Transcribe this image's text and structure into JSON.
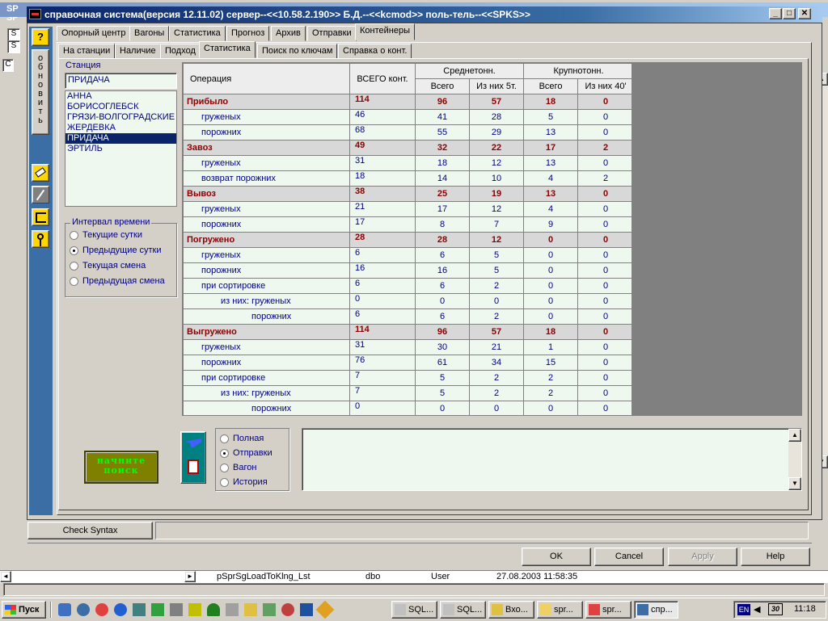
{
  "window": {
    "title": "справочная система(версия 12.11.02) сервер--<<10.58.2.190>> Б.Д.--<<kcmod>> поль-тель--<<SPKS>>"
  },
  "bg": {
    "title_fragment": "SP",
    "item_fragment": "dbo",
    "user_fragment": "User",
    "date_fragment": "27.08.2003 11:58:35",
    "row_name": "pSprSgLoadToKlng_Lst",
    "left_chars": [
      "S",
      "S",
      "C"
    ]
  },
  "leftbar": {
    "help_label": "?",
    "refresh_label": "обновить"
  },
  "tabs_top": [
    "Опорный центр",
    "Вагоны",
    "Статистика",
    "Прогноз",
    "Архив",
    "Отправки",
    "Контейнеры"
  ],
  "tabs_sub": [
    "На станции",
    "Наличие",
    "Подход",
    "Статистика",
    "Поиск по ключам",
    "Справка о конт."
  ],
  "station": {
    "label": "Станция",
    "value": "ПРИДАЧА",
    "items": [
      "АННА",
      "БОРИСОГЛЕБСК",
      "ГРЯЗИ-ВОЛГОГРАДСКИЕ",
      "ЖЕРДЕВКА",
      "ПРИДАЧА",
      "ЭРТИЛЬ"
    ],
    "selected_index": 4
  },
  "interval": {
    "title": "Интервал времени",
    "options": [
      "Текущие сутки",
      "Предыдущие сутки",
      "Текущая смена",
      "Предыдущая смена"
    ],
    "selected": 1
  },
  "table": {
    "headers": {
      "op": "Операция",
      "total": "ВСЕГО конт.",
      "mid": "Среднетонн.",
      "big": "Крупнотонн.",
      "all1": "Всего",
      "from5": "Из них 5т.",
      "all2": "Всего",
      "from40": "Из них 40'"
    },
    "rows": [
      {
        "label": "Прибыло",
        "type": "main",
        "indent": 0,
        "vals": [
          "114",
          "96",
          "57",
          "18",
          "0"
        ]
      },
      {
        "label": "груженых",
        "type": "sub",
        "indent": 1,
        "vals": [
          "46",
          "41",
          "28",
          "5",
          "0"
        ]
      },
      {
        "label": "порожних",
        "type": "sub",
        "indent": 1,
        "vals": [
          "68",
          "55",
          "29",
          "13",
          "0"
        ]
      },
      {
        "label": "Завоз",
        "type": "main",
        "indent": 0,
        "vals": [
          "49",
          "32",
          "22",
          "17",
          "2"
        ]
      },
      {
        "label": "груженых",
        "type": "sub",
        "indent": 1,
        "vals": [
          "31",
          "18",
          "12",
          "13",
          "0"
        ]
      },
      {
        "label": "возврат порожних",
        "type": "sub",
        "indent": 1,
        "vals": [
          "18",
          "14",
          "10",
          "4",
          "2"
        ]
      },
      {
        "label": "Вывоз",
        "type": "main",
        "indent": 0,
        "vals": [
          "38",
          "25",
          "19",
          "13",
          "0"
        ]
      },
      {
        "label": "груженых",
        "type": "sub",
        "indent": 1,
        "vals": [
          "21",
          "17",
          "12",
          "4",
          "0"
        ]
      },
      {
        "label": "порожних",
        "type": "sub",
        "indent": 1,
        "vals": [
          "17",
          "8",
          "7",
          "9",
          "0"
        ]
      },
      {
        "label": "Погружено",
        "type": "main",
        "indent": 0,
        "vals": [
          "28",
          "28",
          "12",
          "0",
          "0"
        ]
      },
      {
        "label": "груженых",
        "type": "sub",
        "indent": 1,
        "vals": [
          "6",
          "6",
          "5",
          "0",
          "0"
        ]
      },
      {
        "label": "порожних",
        "type": "sub",
        "indent": 1,
        "vals": [
          "16",
          "16",
          "5",
          "0",
          "0"
        ]
      },
      {
        "label": "при сортировке",
        "type": "sub",
        "indent": 1,
        "vals": [
          "6",
          "6",
          "2",
          "0",
          "0"
        ]
      },
      {
        "label": "из них: груженых",
        "type": "sub",
        "indent": 2,
        "vals": [
          "0",
          "0",
          "0",
          "0",
          "0"
        ]
      },
      {
        "label": "порожних",
        "type": "sub",
        "indent": 3,
        "vals": [
          "6",
          "6",
          "2",
          "0",
          "0"
        ]
      },
      {
        "label": "Выгружено",
        "type": "main",
        "indent": 0,
        "vals": [
          "114",
          "96",
          "57",
          "18",
          "0"
        ]
      },
      {
        "label": "груженых",
        "type": "sub",
        "indent": 1,
        "vals": [
          "31",
          "30",
          "21",
          "1",
          "0"
        ]
      },
      {
        "label": "порожних",
        "type": "sub",
        "indent": 1,
        "vals": [
          "76",
          "61",
          "34",
          "15",
          "0"
        ]
      },
      {
        "label": "при сортировке",
        "type": "sub",
        "indent": 1,
        "vals": [
          "7",
          "5",
          "2",
          "2",
          "0"
        ]
      },
      {
        "label": "из них: груженых",
        "type": "sub",
        "indent": 2,
        "vals": [
          "7",
          "5",
          "2",
          "2",
          "0"
        ]
      },
      {
        "label": "порожних",
        "type": "sub",
        "indent": 3,
        "vals": [
          "0",
          "0",
          "0",
          "0",
          "0"
        ]
      }
    ]
  },
  "search_button": "начните поиск",
  "mode": {
    "options": [
      "Полная",
      "Отправки",
      "Вагон",
      "История"
    ],
    "selected": 1
  },
  "check_syntax": "Check Syntax",
  "dialog": {
    "ok": "OK",
    "cancel": "Cancel",
    "apply": "Apply",
    "help": "Help"
  },
  "taskbar": {
    "start": "Пуск",
    "tasks": [
      "SQL...",
      "SQL...",
      "Вхо...",
      "spr...",
      "spr...",
      "спр..."
    ],
    "lang": "EN",
    "clock": "11:18",
    "tray_num": "30"
  },
  "colors": {
    "title_start": "#0a246a",
    "accent_panel": "#3a6ea5",
    "main_row_text": "#8b0000",
    "sub_row_text": "#000080",
    "row_bg": "#eef8ee"
  }
}
